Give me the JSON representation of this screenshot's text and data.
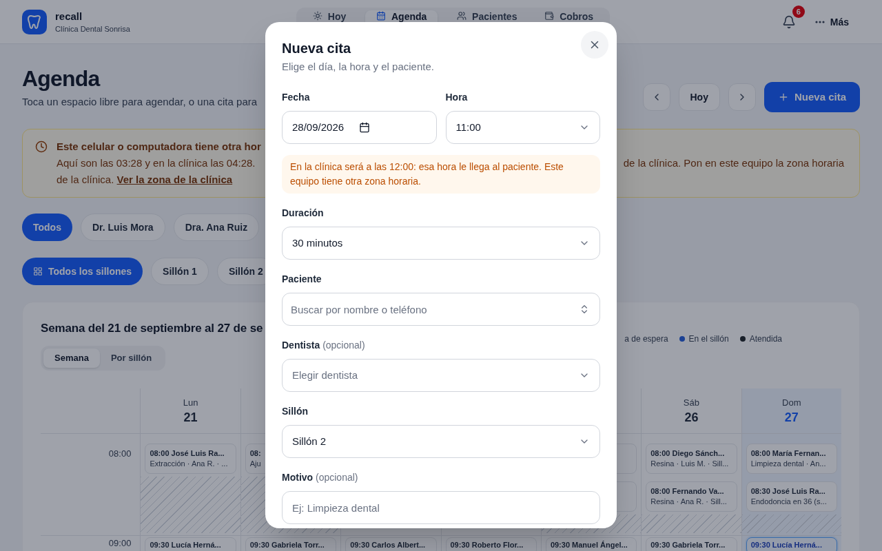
{
  "header": {
    "brand": "recall",
    "clinic": "Clínica Dental Sonrisa",
    "nav": [
      {
        "label": "Hoy",
        "selected": false
      },
      {
        "label": "Agenda",
        "selected": true
      },
      {
        "label": "Pacientes",
        "selected": false
      },
      {
        "label": "Cobros",
        "selected": false
      }
    ],
    "notification_count": "6",
    "more_label": "Más"
  },
  "page": {
    "title": "Agenda",
    "subtitle": "Toca un espacio libre para agendar, o una cita para",
    "today_button": "Hoy",
    "new_button": "Nueva cita"
  },
  "timezone_warning": {
    "title": "Este celular o computadora tiene otra hor",
    "lines": [
      {
        "left": "Aquí son las 03:28 y en la clínica las 04:28.",
        "right": "de la clínica. Pon en este equipo la zona horaria"
      },
      {
        "left": "de la clínica.",
        "link": "Ver la zona de la clínica"
      }
    ]
  },
  "dentist_filters": [
    {
      "label": "Todos",
      "selected": true
    },
    {
      "label": "Dr. Luis Mora",
      "selected": false
    },
    {
      "label": "Dra. Ana Ruiz",
      "selected": false
    }
  ],
  "chair_filters": [
    {
      "kind": "all",
      "label": "Todos los sillones",
      "selected": true
    },
    {
      "kind": "chair",
      "label": "Sillón 1",
      "selected": false
    },
    {
      "kind": "chair",
      "label": "Sillón 2",
      "selected": false
    }
  ],
  "calendar": {
    "title": "Semana del 21 de septiembre al 27 de se",
    "legend": [
      {
        "label": "a de espera"
      },
      {
        "label": "En el sillón",
        "color": "#1c4193"
      },
      {
        "label": "Atendida",
        "color": "#181f29"
      }
    ],
    "views": [
      {
        "label": "Semana",
        "selected": true
      },
      {
        "label": "Por sillón",
        "selected": false
      }
    ],
    "times": [
      "08:00",
      "09:00"
    ],
    "days": [
      {
        "header": {
          "weekday": "Lun",
          "date": "21",
          "today": false
        },
        "row_1": {
          "hatched": true,
          "appointments": [
            {
              "title": "08:00 José Luis Ra...",
              "detail": "Extracción · Ana R. · ...",
              "selected": false
            }
          ]
        },
        "row_2": [
          {
            "title": "09:30 Lucía Herná...",
            "selected": false
          }
        ]
      },
      {
        "row_1": {
          "hatched": true,
          "appointments": [
            {
              "title": "08:",
              "detail": "Aju",
              "selected": false
            }
          ]
        },
        "row_2": [
          {
            "title": "09:30 Gabriela Torr...",
            "selected": false
          }
        ]
      },
      {
        "row_2": [
          {
            "title": "09:30 Carlos Albert...",
            "selected": false
          }
        ]
      },
      {
        "row_2": [
          {
            "title": "09:30 Roberto Flor...",
            "selected": false
          }
        ]
      },
      {
        "row_1": {
          "hatched": true,
          "appointments": [
            {
              "selected": false
            },
            {
              "selected": false
            }
          ]
        },
        "row_2": [
          {
            "title": "09:30 Manuel Ángel...",
            "selected": false
          }
        ]
      },
      {
        "header": {
          "weekday": "Sáb",
          "date": "26",
          "today": false
        },
        "row_1": {
          "hatched": true,
          "appointments": [
            {
              "title": "08:00 Diego Sánch...",
              "detail": "Resina · Luis M. · Sill...",
              "selected": false
            },
            {
              "title": "08:00 Fernando Va...",
              "detail": "Resina · Ana R. · Sill...",
              "selected": false
            }
          ]
        },
        "row_2": [
          {
            "title": "09:30 Gabriela Torr...",
            "selected": false
          }
        ]
      },
      {
        "header": {
          "weekday": "Dom",
          "date": "27",
          "today": true
        },
        "row_1": {
          "hatched": true,
          "appointments": [
            {
              "title": "08:00 María Fernan...",
              "detail": "Limpieza dental · An...",
              "selected": false
            },
            {
              "title": "08:30 José Luis Ra...",
              "detail": "Endodoncia en 36 (s...",
              "selected": false
            }
          ]
        },
        "row_2": [
          {
            "title": "09:30 Lucía Herná...",
            "selected": true
          }
        ]
      }
    ]
  },
  "dialog": {
    "title": "Nueva cita",
    "subtitle": "Elige el día, la hora y el paciente.",
    "date_time_fields": [
      {
        "kind": "date",
        "label": "Fecha",
        "value": "28/09/2026"
      },
      {
        "kind": "select",
        "label": "Hora",
        "value": "11:00"
      }
    ],
    "notice": "En la clínica será a las 12:00: esa hora le llega al paciente. Este equipo tiene otra zona horaria.",
    "fields": [
      {
        "kind": "select",
        "label": "Duración",
        "value": "30 minutos"
      },
      {
        "kind": "combobox",
        "label": "Paciente",
        "placeholder": "Buscar por nombre o teléfono"
      },
      {
        "kind": "select",
        "label": "Dentista",
        "hint": "(opcional)",
        "placeholder": "Elegir dentista"
      },
      {
        "kind": "select",
        "label": "Sillón",
        "value": "Sillón 2"
      },
      {
        "kind": "text",
        "label": "Motivo",
        "hint": "(opcional)",
        "placeholder": "Ej: Limpieza dental"
      }
    ]
  }
}
